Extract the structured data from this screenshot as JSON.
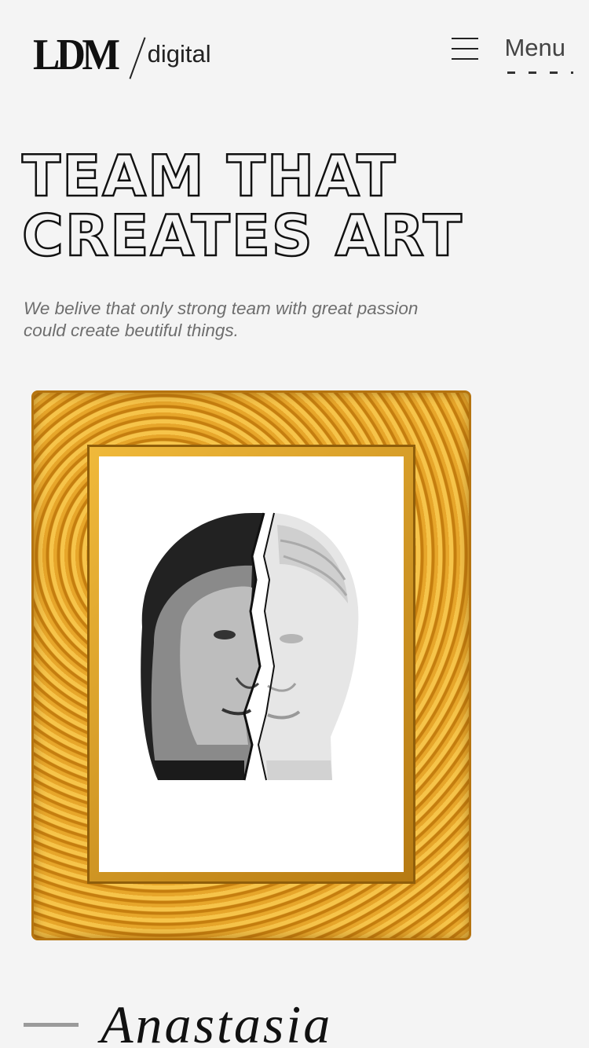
{
  "header": {
    "logo_mark": "LDM",
    "logo_sub": "digital",
    "menu_label": "Menu"
  },
  "hero": {
    "title_line1": "TEAM THAT",
    "title_line2": "CREATES ART",
    "subtitle": "We belive that only strong team with great passion could create beutiful things."
  },
  "feature": {
    "image_description_icon": "gilded-frame-portrait",
    "member_name": "Anastasia"
  },
  "colors": {
    "background": "#f4f4f4",
    "frame_gold": "#d9951c",
    "text_dark": "#111111",
    "subtitle_gray": "#6e6e6e"
  }
}
